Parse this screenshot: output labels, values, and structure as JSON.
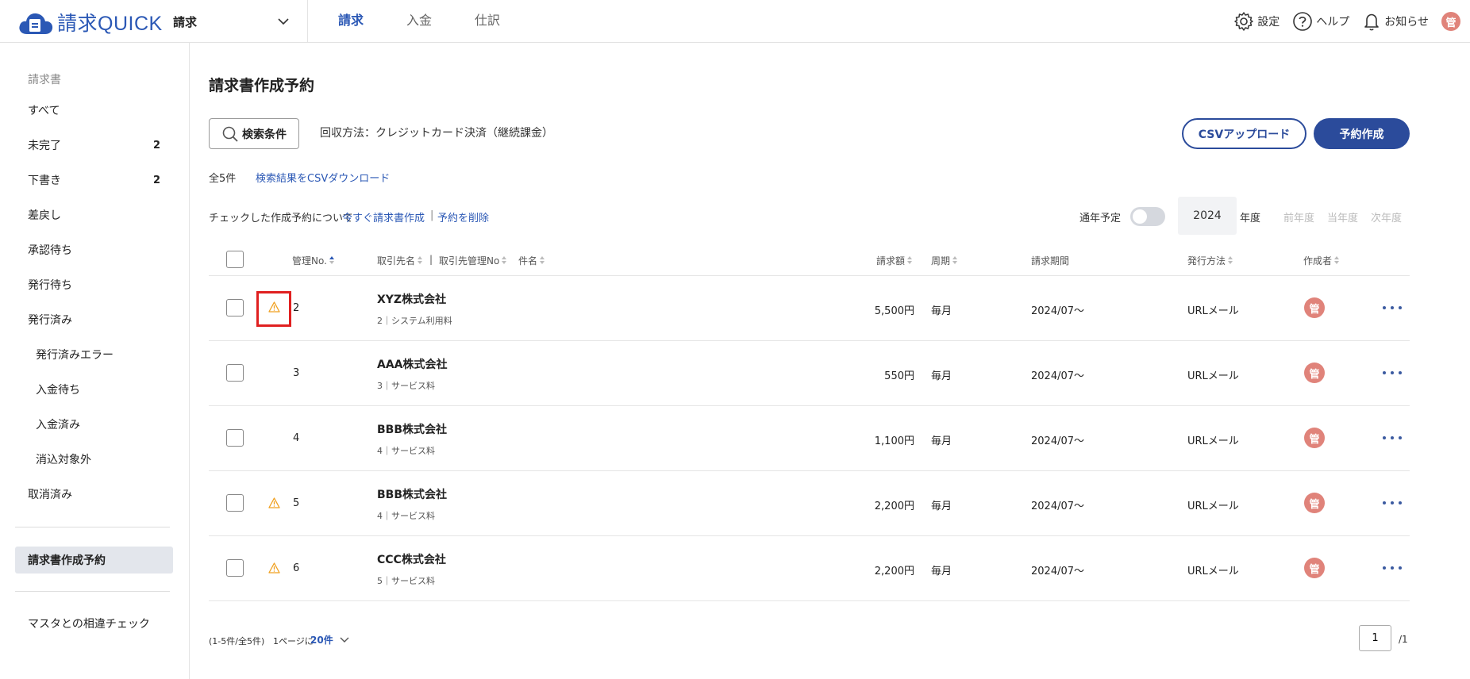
{
  "app": {
    "name": "請求QUICK",
    "product": "請求",
    "brand_color": "#2b58b5",
    "accent_color": "#2b4b9b",
    "user_initial": "管"
  },
  "main_nav": [
    {
      "label": "請求",
      "active": true
    },
    {
      "label": "入金",
      "active": false
    },
    {
      "label": "仕訳",
      "active": false
    }
  ],
  "top_actions": {
    "settings": "設定",
    "help": "ヘルプ",
    "notifications": "お知らせ"
  },
  "sidebar": {
    "heading": "請求書",
    "items": [
      {
        "label": "すべて",
        "count": ""
      },
      {
        "label": "未完了",
        "count": "2"
      },
      {
        "label": "下書き",
        "count": "2"
      },
      {
        "label": "差戻し",
        "count": ""
      },
      {
        "label": "承認待ち",
        "count": ""
      },
      {
        "label": "発行待ち",
        "count": ""
      },
      {
        "label": "発行済み",
        "count": ""
      },
      {
        "label": "発行済みエラー",
        "count": ""
      },
      {
        "label": "入金待ち",
        "count": ""
      },
      {
        "label": "入金済み",
        "count": ""
      },
      {
        "label": "消込対象外",
        "count": ""
      },
      {
        "label": "取消済み",
        "count": ""
      }
    ],
    "active_item": "請求書作成予約",
    "bottom_item": "マスタとの相違チェック"
  },
  "page": {
    "title": "請求書作成予約",
    "search_button": "検索条件",
    "filter_text": "回収方法：クレジットカード決済（継続課金）",
    "csv_upload": "CSVアップロード",
    "create_button": "予約作成",
    "total_count": "全5件",
    "csv_download": "検索結果をCSVダウンロード",
    "bulk_label": "チェックした作成予約について",
    "bulk_create": "今すぐ請求書作成",
    "bulk_sep": "|",
    "bulk_delete": "予約を削除",
    "annual_label": "通年予定",
    "annual_toggle_on": false,
    "year_value": "2024",
    "year_label": "年度",
    "year_prev": "前年度",
    "year_current": "当年度",
    "year_next": "次年度"
  },
  "table": {
    "headers": {
      "number": "管理No.",
      "client": "取引先名",
      "client_sep": "|",
      "client_no": "取引先管理No",
      "subject": "件名",
      "amount": "請求額",
      "cycle": "周期",
      "period": "請求期間",
      "method": "発行方法",
      "creator": "作成者"
    },
    "rows": [
      {
        "no": "2",
        "warning": true,
        "client": "XYZ株式会社",
        "sub": "2｜システム利用料",
        "amount": "5,500円",
        "cycle": "毎月",
        "period": "2024/07～",
        "method": "URLメール",
        "creator": "管"
      },
      {
        "no": "3",
        "warning": false,
        "client": "AAA株式会社",
        "sub": "3｜サービス料",
        "amount": "550円",
        "cycle": "毎月",
        "period": "2024/07～",
        "method": "URLメール",
        "creator": "管"
      },
      {
        "no": "4",
        "warning": false,
        "client": "BBB株式会社",
        "sub": "4｜サービス料",
        "amount": "1,100円",
        "cycle": "毎月",
        "period": "2024/07～",
        "method": "URLメール",
        "creator": "管"
      },
      {
        "no": "5",
        "warning": true,
        "client": "BBB株式会社",
        "sub": "4｜サービス料",
        "amount": "2,200円",
        "cycle": "毎月",
        "period": "2024/07～",
        "method": "URLメール",
        "creator": "管"
      },
      {
        "no": "6",
        "warning": true,
        "client": "CCC株式会社",
        "sub": "5｜サービス料",
        "amount": "2,200円",
        "cycle": "毎月",
        "period": "2024/07～",
        "method": "URLメール",
        "creator": "管"
      }
    ]
  },
  "footer": {
    "range_text": "(1-5件/全5件)",
    "per_page_label": "1ページに",
    "per_page_value": "20件",
    "page_value": "1",
    "page_total": "/1"
  }
}
